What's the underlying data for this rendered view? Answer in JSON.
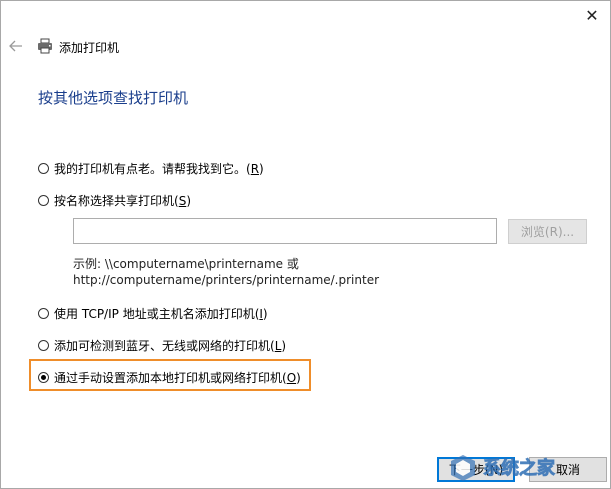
{
  "window": {
    "close_glyph": "✕",
    "header_title": "添加打印机",
    "page_title": "按其他选项查找打印机"
  },
  "options": [
    {
      "text": "我的打印机有点老。请帮我找到它。(",
      "key": "R",
      "suffix": ")",
      "checked": false
    },
    {
      "text": "按名称选择共享打印机(",
      "key": "S",
      "suffix": ")",
      "checked": false
    },
    {
      "text": "使用 TCP/IP 地址或主机名添加打印机(",
      "key": "I",
      "suffix": ")",
      "checked": false
    },
    {
      "text": "添加可检测到蓝牙、无线或网络的打印机(",
      "key": "L",
      "suffix": ")",
      "checked": false
    },
    {
      "text": "通过手动设置添加本地打印机或网络打印机(",
      "key": "O",
      "suffix": ")",
      "checked": true
    }
  ],
  "shared_printer": {
    "input_value": "",
    "browse_label": "浏览(R)...",
    "example_line1": "示例: \\\\computername\\printername 或",
    "example_line2": "http://computername/printers/printername/.printer"
  },
  "buttons": {
    "next_label": "下一步(N)",
    "cancel_label": "取消"
  },
  "watermark": {
    "text": "系统之家"
  },
  "colors": {
    "title_blue": "#1a3e8c",
    "highlight_orange": "#ef8d2a",
    "focus_blue": "#0078d7"
  }
}
